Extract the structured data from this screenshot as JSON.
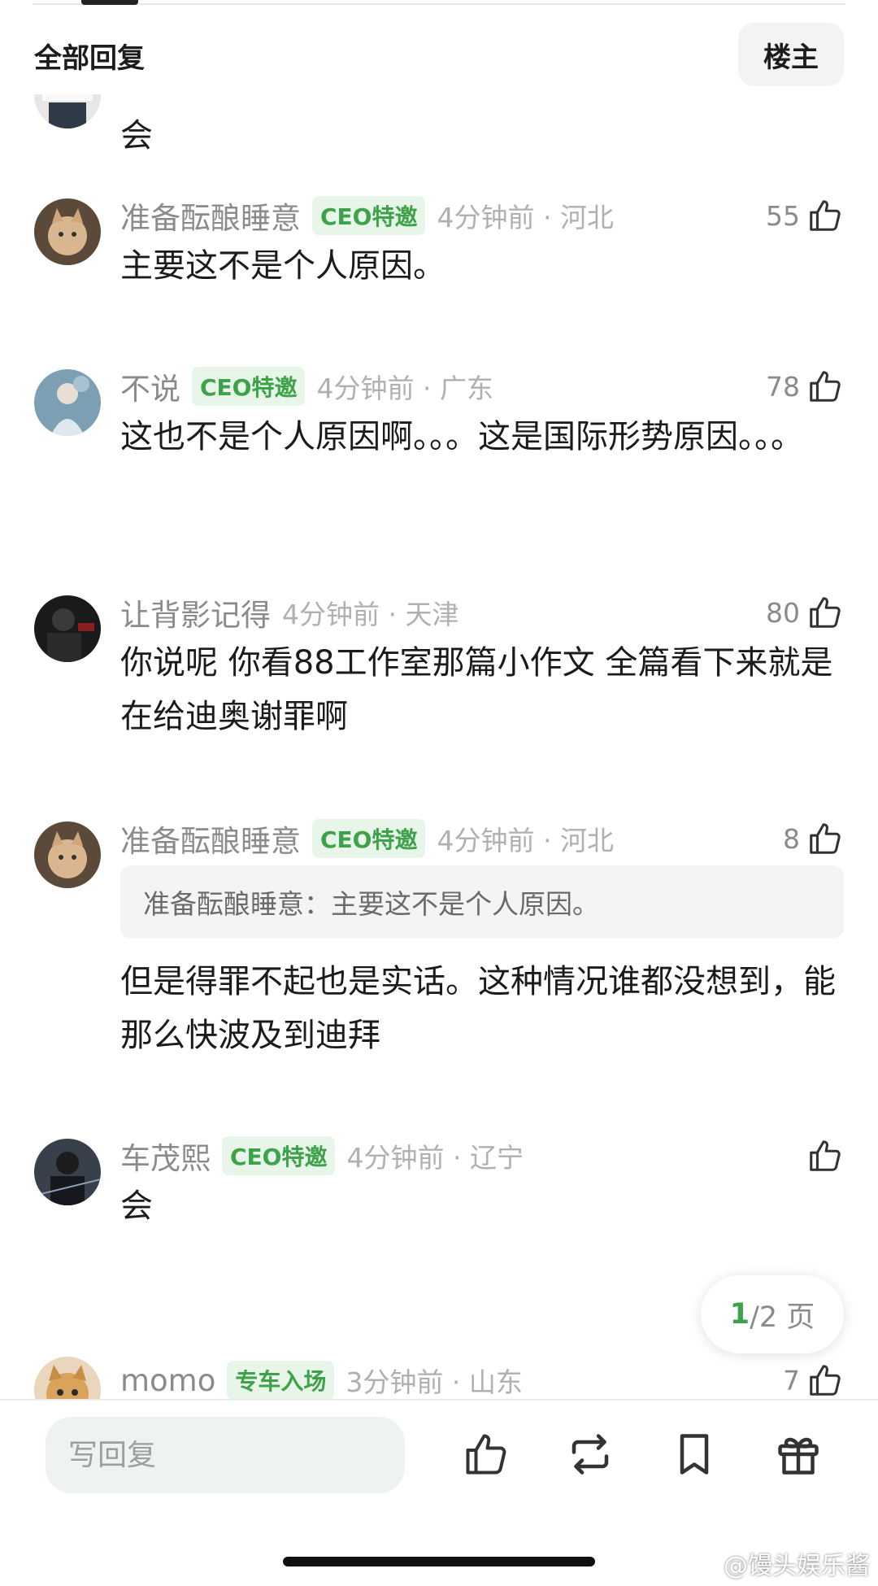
{
  "header": {
    "title": "全部回复",
    "owner_button": "楼主"
  },
  "comments": [
    {
      "username": "",
      "badge": "",
      "time": "",
      "likes": "",
      "text": "会"
    },
    {
      "username": "准备酝酿睡意",
      "badge": "CEO特邀",
      "time": "4分钟前 · 河北",
      "likes": "55",
      "text": "主要这不是个人原因。"
    },
    {
      "username": "不说",
      "badge": "CEO特邀",
      "time": "4分钟前 · 广东",
      "likes": "78",
      "text": "这也不是个人原因啊。。。这是国际形势原因。。。"
    },
    {
      "username": "让背影记得",
      "badge": "",
      "time": "4分钟前 · 天津",
      "likes": "80",
      "text": "你说呢 你看88工作室那篇小作文 全篇看下来就是在给迪奥谢罪啊"
    },
    {
      "username": "准备酝酿睡意",
      "badge": "CEO特邀",
      "time": "4分钟前 · 河北",
      "likes": "8",
      "quote": "准备酝酿睡意：主要这不是个人原因。",
      "text": "但是得罪不起也是实话。这种情况谁都没想到，能那么快波及到迪拜"
    },
    {
      "username": "车茂熙",
      "badge": "CEO特邀",
      "time": "4分钟前 · 辽宁",
      "likes": "",
      "text": "会"
    },
    {
      "username": "momo",
      "badge": "专车入场",
      "time": "3分钟前 · 山东",
      "likes": "7",
      "text": ""
    }
  ],
  "pager": {
    "current": "1",
    "total": "/2 页"
  },
  "bottom_bar": {
    "reply_placeholder": "写回复",
    "icons": [
      "thumbs-up-icon",
      "repost-icon",
      "bookmark-icon",
      "gift-icon"
    ]
  },
  "watermark": "@馒头娱乐酱",
  "colors": {
    "accent_green": "#3ea24a",
    "badge_bg": "#e7f6e8",
    "meta_gray": "#8b8b8b"
  }
}
